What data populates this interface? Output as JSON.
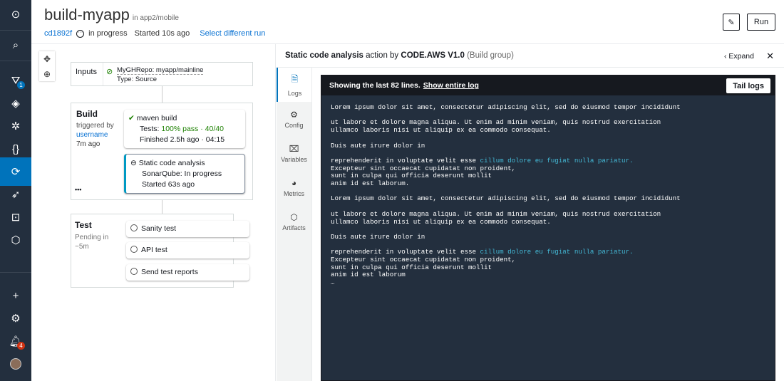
{
  "header": {
    "title": "build-myapp",
    "location": "in app2/mobile",
    "commit": "cd1892f",
    "status": "in progress",
    "started": "Started 10s ago",
    "select_run": "Select different run",
    "run_button": "Run"
  },
  "sidebar": {
    "filter_badge": "1",
    "notif_badge": "4"
  },
  "pipeline": {
    "inputs": {
      "label": "Inputs",
      "repo": "MyGHRepo: myapp/mainline",
      "type": "Type: Source"
    },
    "build": {
      "title": "Build",
      "triggered": "triggered by",
      "user": "username",
      "when": "7m ago",
      "more": "•••",
      "actions": [
        {
          "name": "maven build",
          "tests_label": "Tests:",
          "tests_value": "100% pass · 40/40",
          "finished": "Finished 2.5h ago · 04:15"
        },
        {
          "name": "Static code analysis",
          "status": "SonarQube: In progress",
          "started": "Started 63s ago"
        }
      ]
    },
    "test": {
      "title": "Test",
      "pending": "Pending in ~5m",
      "actions": [
        "Sanity test",
        "API test",
        "Send test reports"
      ]
    }
  },
  "panel": {
    "action_name": "Static code analysis",
    "by": "action by",
    "provider": "CODE.AWS V1.0",
    "group": "(Build group)",
    "expand": "Expand",
    "tabs": [
      "Logs",
      "Config",
      "Variables",
      "Metrics",
      "Artifacts"
    ],
    "log_header": "Showing the last 82 lines.",
    "show_entire": "Show entire log",
    "tail": "Tail logs",
    "lines": [
      "Lorem ipsum dolor sit amet, consectetur adipiscing elit, sed do eiusmod tempor incididunt",
      "",
      "ut labore et dolore magna aliqua. Ut enim ad minim veniam, quis nostrud exercitation",
      "ullamco laboris nisi ut aliquip ex ea commodo consequat.",
      "",
      "Duis aute irure dolor in",
      "",
      "reprehenderit in voluptate velit esse ",
      "Excepteur sint occaecat cupidatat non proident,",
      "sunt in culpa qui officia deserunt mollit",
      "anim id est laborum.",
      "",
      "Lorem ipsum dolor sit amet, consectetur adipiscing elit, sed do eiusmod tempor incididunt",
      "",
      "ut labore et dolore magna aliqua. Ut enim ad minim veniam, quis nostrud exercitation",
      "ullamco laboris nisi ut aliquip ex ea commodo consequat.",
      "",
      "Duis aute irure dolor in",
      "",
      "reprehenderit in voluptate velit esse ",
      "Excepteur sint occaecat cupidatat non proident,",
      "sunt in culpa qui officia deserunt mollit",
      "anim id est laborum",
      "…"
    ],
    "highlight": "cillum dolore eu fugiat nulla pariatur."
  }
}
